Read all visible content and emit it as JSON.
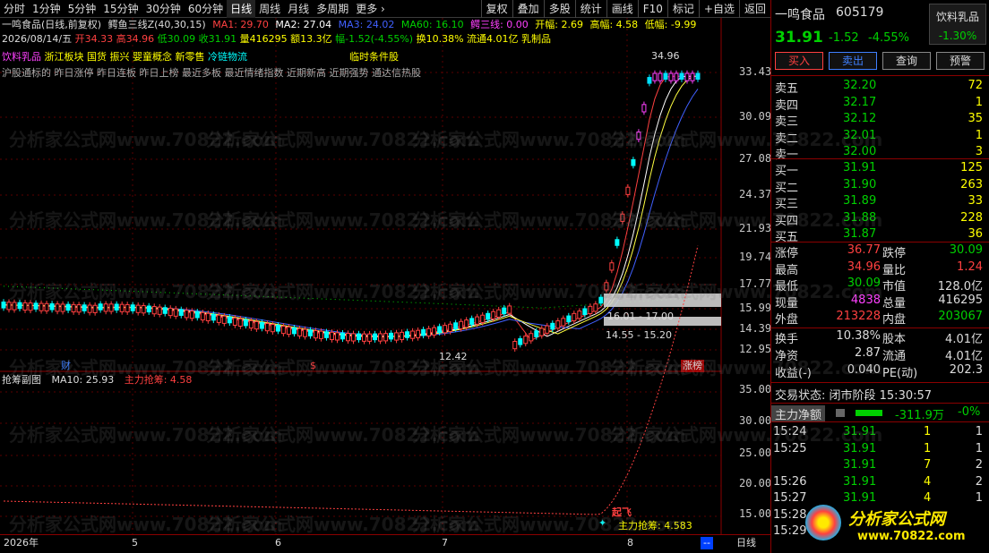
{
  "toolbar": {
    "items": [
      "分时",
      "1分钟",
      "5分钟",
      "15分钟",
      "30分钟",
      "60分钟",
      "日线",
      "周线",
      "月线",
      "多周期",
      "更多 ›"
    ],
    "active_index": 6,
    "right_items": [
      "复权",
      "叠加",
      "多股",
      "统计",
      "画线",
      "F10",
      "标记",
      "+自选",
      "返回"
    ]
  },
  "header": {
    "title": "一鸣食品(日线,前复权)",
    "indicator_name": "鳄鱼三线Z(40,30,15)",
    "ma1": "MA1: 29.70",
    "ma2": "MA2: 27.04",
    "ma3": "MA3: 24.02",
    "ma60": "MA60: 16.10",
    "zero_line": "鳄三线: 0.00",
    "open_amp": "开幅: 2.69",
    "high_amp": "高幅: 4.58",
    "low_amp": "低幅: -9.99",
    "date": "2026/08/14/五",
    "open": "开34.33",
    "high": "高34.96",
    "low": "低30.09",
    "close": "收31.91",
    "volume": "量416295",
    "amount": "额13.3亿",
    "change": "幅-1.52(-4.55%)",
    "turnover": "换10.38%",
    "float": "流通4.01亿",
    "industry": "乳制品",
    "concept_tags": [
      "饮料乳品",
      "浙江板块",
      "国货",
      "振兴",
      "婴童概念",
      "新零售",
      "冷链物流"
    ],
    "temp_condition": "临时条件股",
    "hot_tags": "沪股通标的 昨日涨停 昨日连板 昨日上榜 最近多板 最近情绪指数 近期新高 近期强势 通达信热股"
  },
  "main_axis": [
    "33.43",
    "30.09",
    "27.08",
    "24.37",
    "21.93",
    "19.74",
    "17.77",
    "15.99",
    "14.39",
    "12.95"
  ],
  "annotations": {
    "peak": "34.96",
    "low": "12.42",
    "box1": "16.01 - 17.00",
    "box2": "14.55 - 15.20",
    "mark_cai": "财",
    "mark_dollar": "$",
    "mark_zt": "涨榜"
  },
  "sub": {
    "title": "抢筹副图",
    "ma10": "MA10: 25.93",
    "zl": "主力抢筹: 4.58",
    "axis": [
      "35.00",
      "30.00",
      "25.00",
      "20.00",
      "15.00"
    ],
    "qifei": "起飞",
    "zl_label": "主力抢筹: 4.583"
  },
  "bottom": {
    "dates": [
      "2026年",
      "5",
      "6",
      "7",
      "8"
    ],
    "period": "日线",
    "dash": "--"
  },
  "quote": {
    "name": "一鸣食品",
    "code": "605179",
    "sector": "饮料乳品",
    "sector_change": "-1.30%",
    "price": "31.91",
    "change": "-1.52",
    "pct": "-4.55%",
    "buttons": [
      "买入",
      "卖出",
      "查询",
      "预警"
    ],
    "sells": [
      {
        "label": "卖五",
        "price": "32.20",
        "vol": "72"
      },
      {
        "label": "卖四",
        "price": "32.17",
        "vol": "1"
      },
      {
        "label": "卖三",
        "price": "32.12",
        "vol": "35"
      },
      {
        "label": "卖二",
        "price": "32.01",
        "vol": "1"
      },
      {
        "label": "卖一",
        "price": "32.00",
        "vol": "3"
      }
    ],
    "buys": [
      {
        "label": "买一",
        "price": "31.91",
        "vol": "125"
      },
      {
        "label": "买二",
        "price": "31.90",
        "vol": "263"
      },
      {
        "label": "买三",
        "price": "31.89",
        "vol": "33"
      },
      {
        "label": "买四",
        "price": "31.88",
        "vol": "228"
      },
      {
        "label": "买五",
        "price": "31.87",
        "vol": "36"
      }
    ],
    "stats": [
      {
        "l1": "涨停",
        "v1": "36.77",
        "l2": "跌停",
        "v2": "30.09"
      },
      {
        "l1": "最高",
        "v1": "34.96",
        "l2": "量比",
        "v2": "1.24"
      },
      {
        "l1": "最低",
        "v1": "30.09",
        "l2": "市值",
        "v2": "128.0亿"
      },
      {
        "l1": "现量",
        "v1": "4838",
        "l2": "总量",
        "v2": "416295"
      },
      {
        "l1": "外盘",
        "v1": "213228",
        "l2": "内盘",
        "v2": "203067"
      }
    ],
    "stats2": [
      {
        "l1": "换手",
        "v1": "10.38%",
        "l2": "股本",
        "v2": "4.01亿"
      },
      {
        "l1": "净资",
        "v1": "2.87",
        "l2": "流通",
        "v2": "4.01亿"
      },
      {
        "l1": "收益(-)",
        "v1": "0.040",
        "l2": "PE(动)",
        "v2": "202.3"
      }
    ],
    "trade_state": "交易状态: 闭市阶段 15:30:57",
    "net_label": "主力净额",
    "net_value": "-311.9万",
    "net_pct": "-0%",
    "ticks": [
      {
        "t": "15:24",
        "p": "31.91",
        "v": "1",
        "n": "1"
      },
      {
        "t": "15:25",
        "p": "31.91",
        "v": "1",
        "n": "1"
      },
      {
        "t": "",
        "p": "31.91",
        "v": "7",
        "n": "2"
      },
      {
        "t": "15:26",
        "p": "31.91",
        "v": "4",
        "n": "2"
      },
      {
        "t": "15:27",
        "p": "31.91",
        "v": "4",
        "n": "1"
      },
      {
        "t": "15:28",
        "p": "",
        "v": "",
        "n": ""
      },
      {
        "t": "15:29",
        "p": "",
        "v": "",
        "n": ""
      }
    ],
    "logo_text": "分析家公式网",
    "logo_url": "www.70822.com"
  },
  "watermark": "分析家公式网www.70822.com"
}
